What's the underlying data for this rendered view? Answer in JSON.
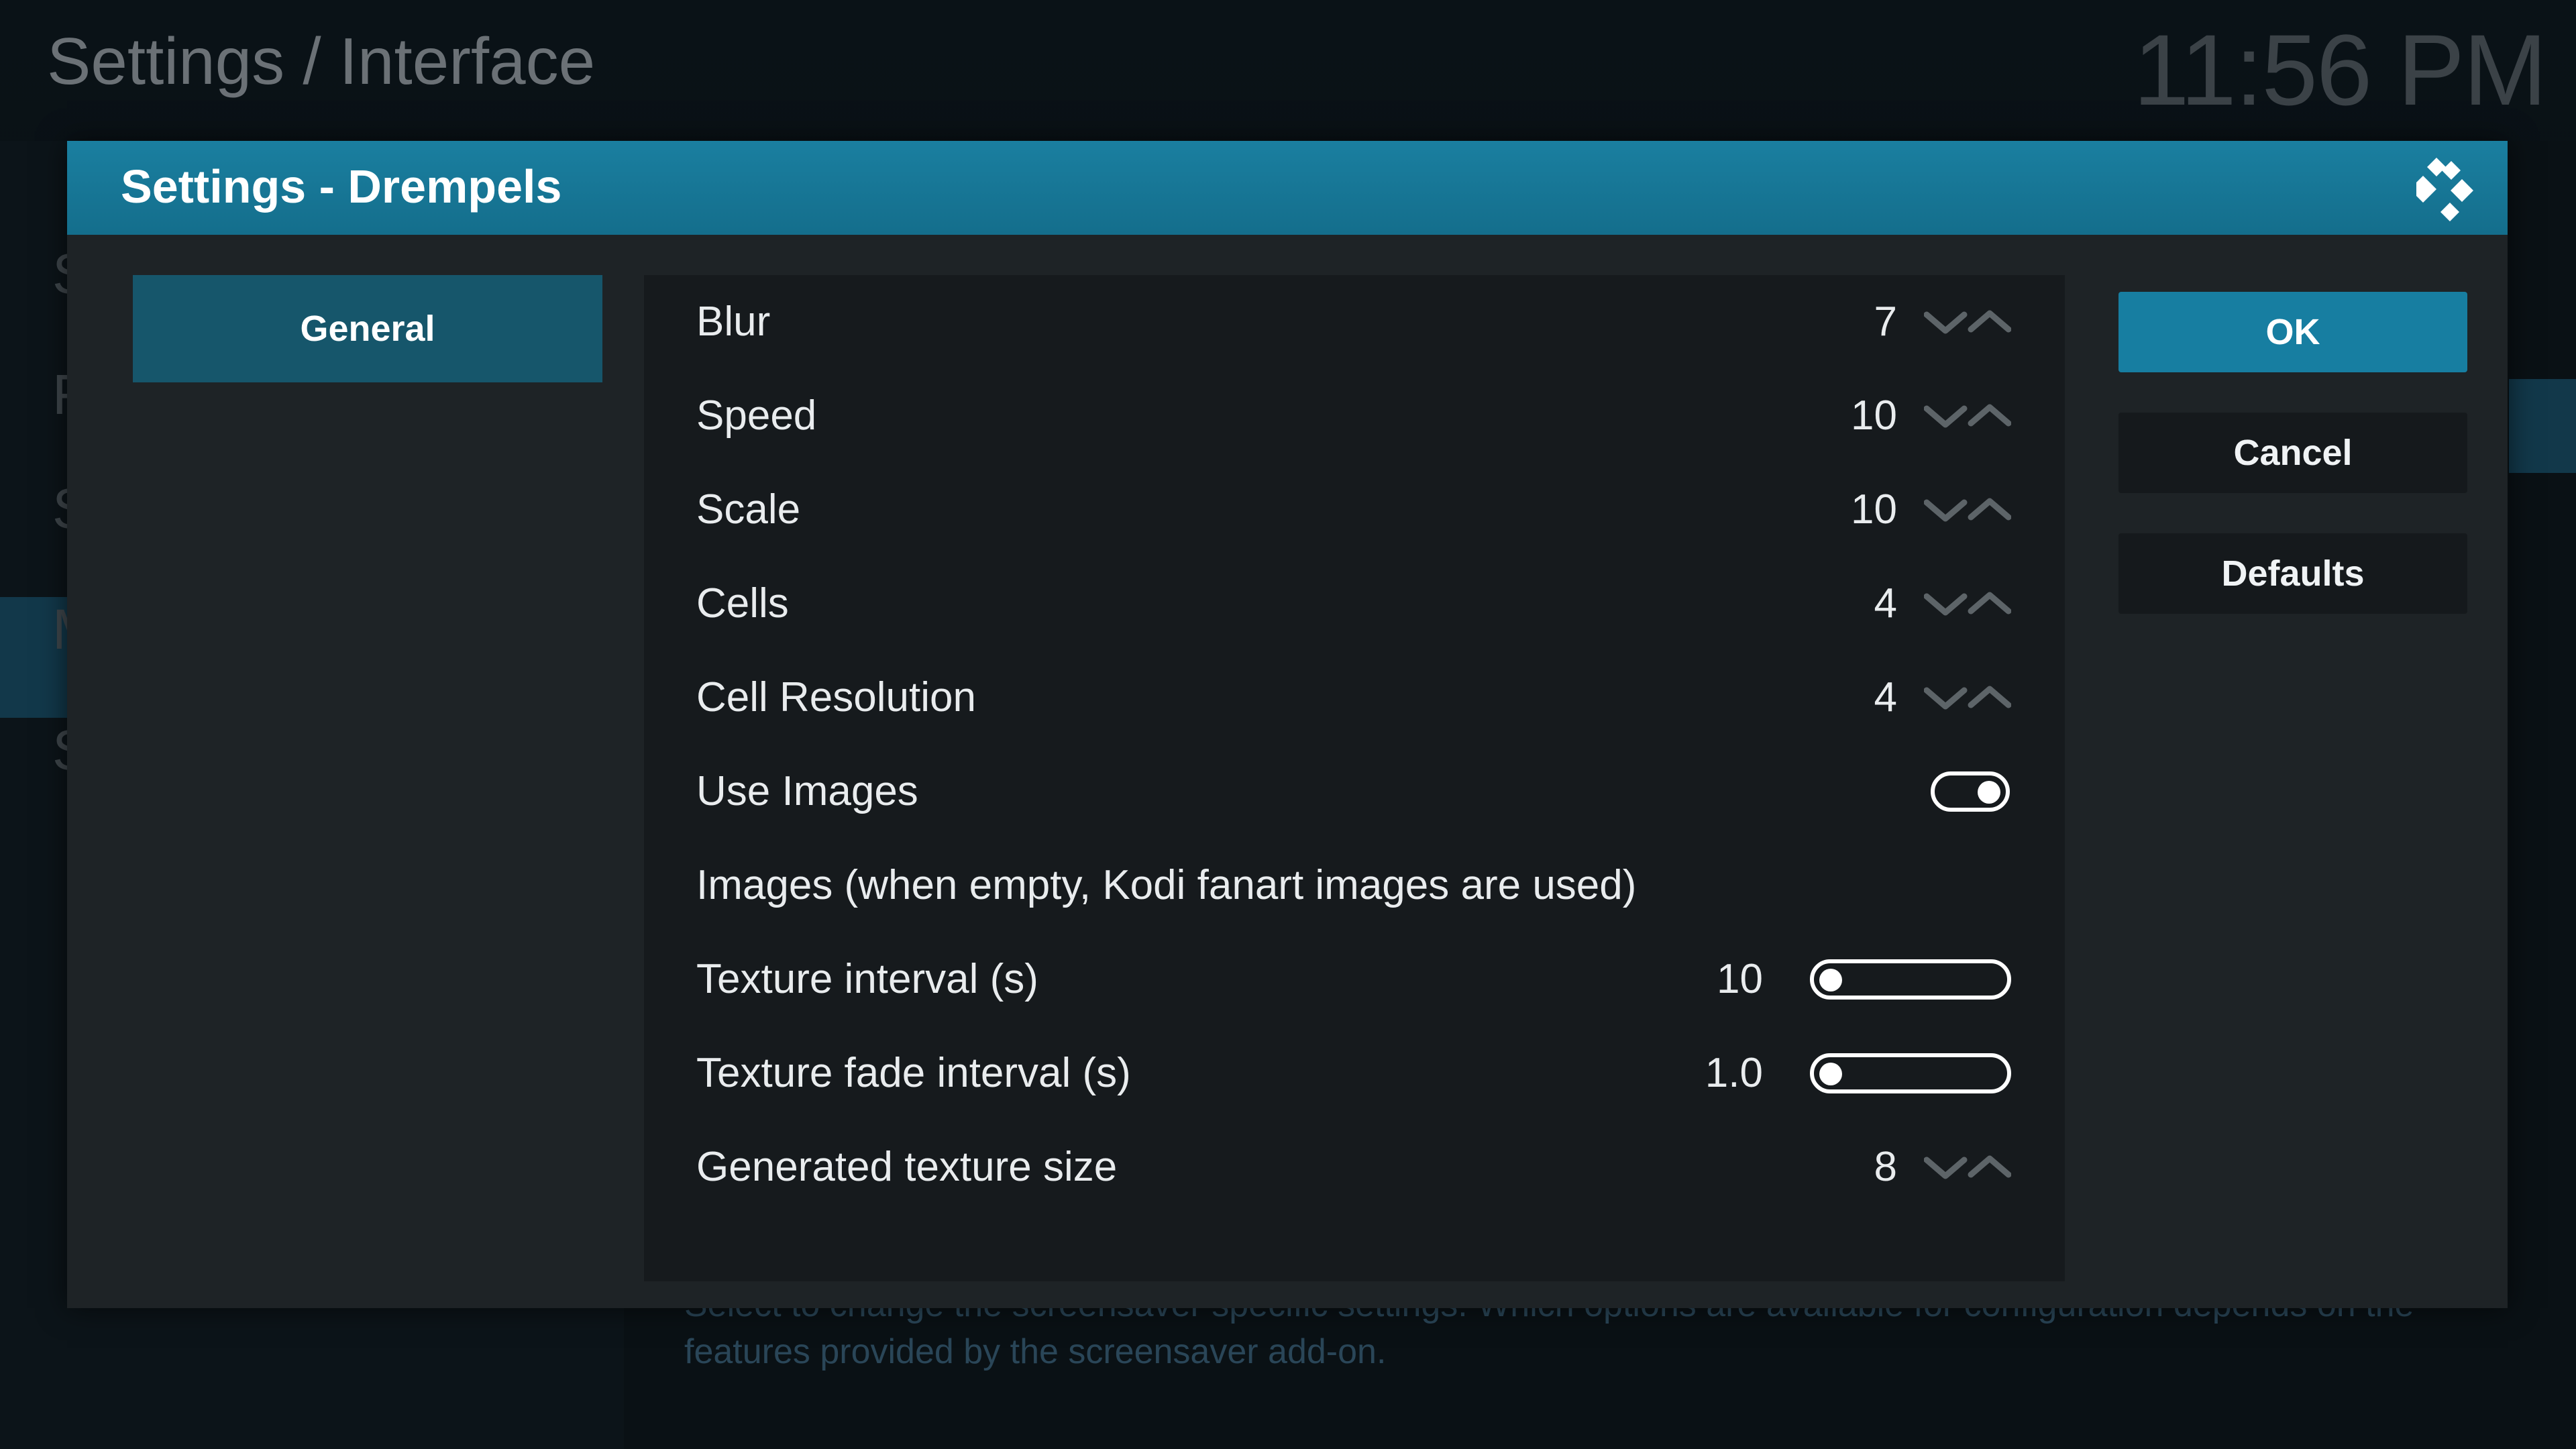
{
  "background": {
    "page_title": "Settings / Interface",
    "clock": "11:56 PM",
    "side_items": [
      "S",
      "F",
      "S",
      "M",
      "S"
    ],
    "footer_line1": "Select to change the screensaver specific settings. Which options are available for configuration depends on the",
    "footer_line2": "features provided by the screensaver add-on."
  },
  "dialog": {
    "title": "Settings - Drempels",
    "logo_icon": "kodi-logo-icon",
    "categories": [
      {
        "label": "General",
        "selected": true
      }
    ],
    "settings": [
      {
        "label": "Blur",
        "value": "7",
        "control": "spinner"
      },
      {
        "label": "Speed",
        "value": "10",
        "control": "spinner"
      },
      {
        "label": "Scale",
        "value": "10",
        "control": "spinner"
      },
      {
        "label": "Cells",
        "value": "4",
        "control": "spinner"
      },
      {
        "label": "Cell Resolution",
        "value": "4",
        "control": "spinner"
      },
      {
        "label": "Use Images",
        "value": "",
        "control": "toggle",
        "checked": true
      },
      {
        "label": "Images (when empty, Kodi fanart images are used)",
        "value": "",
        "control": "path"
      },
      {
        "label": "Texture interval (s)",
        "value": "10",
        "control": "slider",
        "fraction": 0.0
      },
      {
        "label": "Texture fade interval (s)",
        "value": "1.0",
        "control": "slider",
        "fraction": 0.0
      },
      {
        "label": "Generated texture size",
        "value": "8",
        "control": "spinner"
      }
    ],
    "buttons": {
      "ok": "OK",
      "cancel": "Cancel",
      "defaults": "Defaults"
    },
    "colors": {
      "header": "#177ea1",
      "selected_category": "#16566b",
      "ok_button": "#177ea1",
      "spin_arrows": "#5d6468"
    }
  }
}
